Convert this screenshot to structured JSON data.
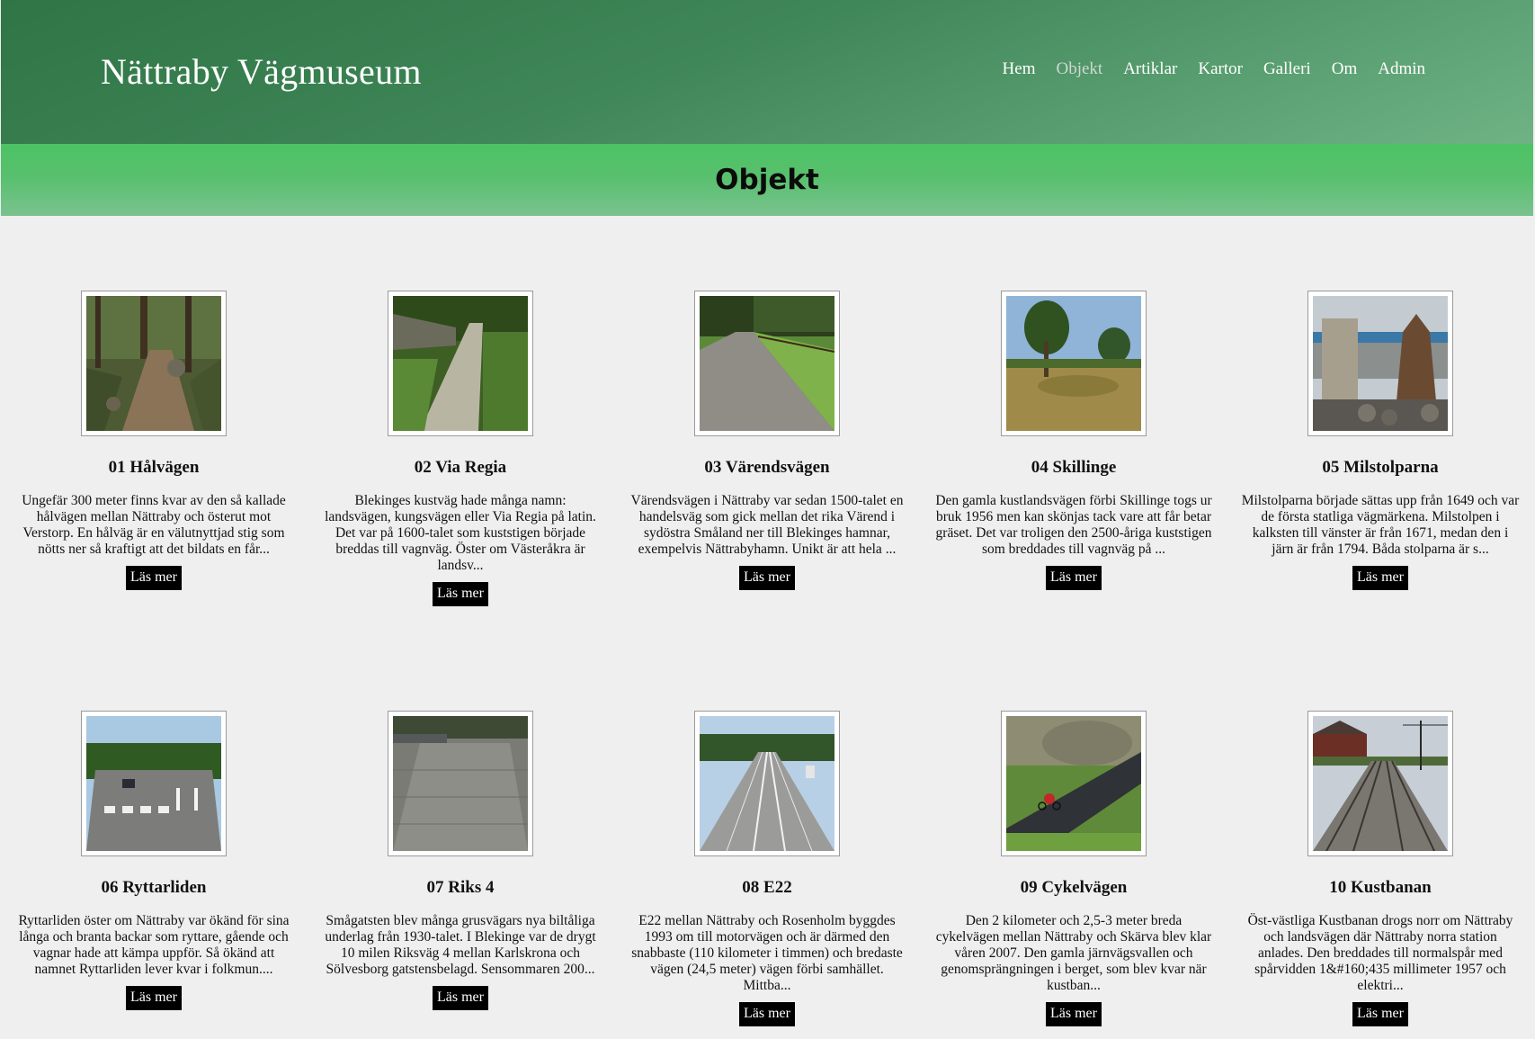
{
  "header": {
    "site_title": "Nättraby Vägmuseum",
    "nav": [
      "Hem",
      "Objekt",
      "Artiklar",
      "Kartor",
      "Galleri",
      "Om",
      "Admin"
    ],
    "active": "Objekt"
  },
  "banner": {
    "title": "Objekt"
  },
  "read_more_label": "Läs mer",
  "items": [
    {
      "title": "01 Hålvägen",
      "text": "Ungefär 300 meter finns kvar av den så kallade hålvägen mellan Nättraby och österut mot Verstorp. En hålväg är en välutnyttjad stig som nötts ner så kraftigt att det bildats en får...",
      "image": "forest-path-photo"
    },
    {
      "title": "02 Via Regia",
      "text": "Blekinges kustväg hade många namn: landsvägen, kungsvägen eller Via Regia på latin. Det var på 1600-talet som kuststigen började breddas till vagnväg. Öster om Västeråkra är landsv...",
      "image": "gravel-lane-photo"
    },
    {
      "title": "03 Värendsvägen",
      "text": "Värendsvägen i Nättraby var sedan 1500-talet en handelsväg som gick mellan det rika Värend i sydöstra Småland ner till Blekinges hamnar, exempelvis Nättrabyhamn. Unikt är att hela ...",
      "image": "country-road-photo"
    },
    {
      "title": "04 Skillinge",
      "text": "Den gamla kustlandsvägen förbi Skillinge togs ur bruk 1956 men kan skönjas tack vare att får betar gräset. Det var troligen den 2500-åriga kuststigen som breddades till vagnväg på ...",
      "image": "grass-field-photo"
    },
    {
      "title": "05 Milstolparna",
      "text": "Milstolparna började sättas upp från 1649 och var de första statliga vägmärkena. Milstolpen i kalksten till vänster är från 1671, medan den i järn är från 1794. Båda stolparna är s...",
      "image": "milestones-photo"
    },
    {
      "title": "06 Ryttarliden",
      "text": "Ryttarliden öster om Nättraby var ökänd för sina långa och branta backar som ryttare, gående och vagnar hade att kämpa uppför. Så ökänd att namnet Ryttarliden lever kvar i folkmun....",
      "image": "crosswalk-road-photo"
    },
    {
      "title": "07 Riks 4",
      "text": "Smågatsten blev många grusvägars nya biltåliga underlag från 1930-talet. I Blekinge var de drygt 10 milen Riksväg 4 mellan Karlskrona och Sölvesborg gatstensbelagd. Sensommaren 200...",
      "image": "cobblestone-road-photo"
    },
    {
      "title": "08 E22",
      "text": "E22 mellan Nättraby och Rosenholm byggdes 1993 om till motorvägen och är därmed den snabbaste (110 kilometer i timmen) och bredaste vägen (24,5 meter) vägen förbi samhället. Mittba...",
      "image": "motorway-photo"
    },
    {
      "title": "09 Cykelvägen",
      "text": "Den 2 kilometer och 2,5-3 meter breda cykelvägen mellan Nättraby och Skärva blev klar våren 2007. Den gamla järnvägsvallen och genomsprängningen i berget, som blev kvar när kustban...",
      "image": "cycle-path-photo"
    },
    {
      "title": "10 Kustbanan",
      "text": "Öst-västliga Kustbanan drogs norr om Nättraby och landsvägen där Nättraby norra station anlades. Den breddades till normalspår med spårvidden 1&#160;435 millimeter 1957 och elektri...",
      "image": "railway-photo"
    }
  ]
}
